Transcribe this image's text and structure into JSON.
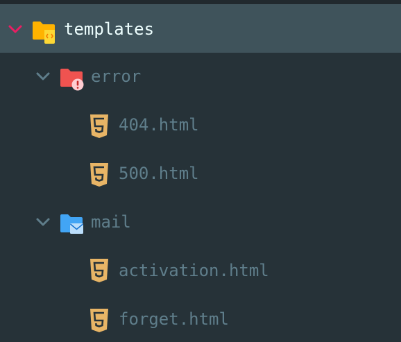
{
  "tree": {
    "root": {
      "label": "templates",
      "icon": "folder-templates-open-icon",
      "expanded": true
    },
    "folders": [
      {
        "label": "error",
        "icon": "folder-error-open-icon",
        "expanded": true,
        "files": [
          {
            "label": "404.html",
            "icon": "html5-file-icon"
          },
          {
            "label": "500.html",
            "icon": "html5-file-icon"
          }
        ]
      },
      {
        "label": "mail",
        "icon": "folder-mail-open-icon",
        "expanded": true,
        "files": [
          {
            "label": "activation.html",
            "icon": "html5-file-icon"
          },
          {
            "label": "forget.html",
            "icon": "html5-file-icon"
          }
        ]
      }
    ]
  },
  "colors": {
    "background": "#263238",
    "selected_row": "#3f535b",
    "selected_chevron": "#e91e63",
    "chevron": "#5f7e8b",
    "label": "#5f7e8b",
    "selected_label": "#eeffff",
    "html_icon": "#e8b566",
    "templates_folder": "#ffb300",
    "error_folder": "#ef5350",
    "mail_folder": "#42a5f5"
  }
}
